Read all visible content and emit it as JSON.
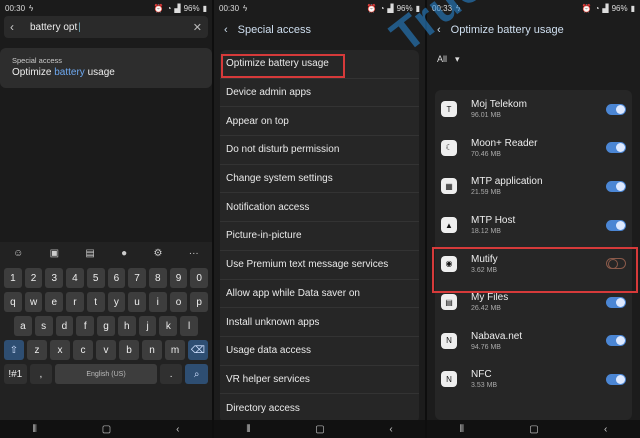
{
  "panel1": {
    "status": {
      "time": "00:30",
      "battery": "96%"
    },
    "search": {
      "value": "battery opt"
    },
    "result": {
      "category": "Special access",
      "title_pre": "Optimize ",
      "title_hl": "battery",
      "title_post": " usage"
    },
    "keyboard": {
      "row1": [
        "1",
        "2",
        "3",
        "4",
        "5",
        "6",
        "7",
        "8",
        "9",
        "0"
      ],
      "row2": [
        "q",
        "w",
        "e",
        "r",
        "t",
        "y",
        "u",
        "i",
        "o",
        "p"
      ],
      "row3": [
        "a",
        "s",
        "d",
        "f",
        "g",
        "h",
        "j",
        "k",
        "l"
      ],
      "row4": [
        "z",
        "x",
        "c",
        "v",
        "b",
        "n",
        "m"
      ],
      "sym": "!#1",
      "comma": ",",
      "space": "English (US)",
      "period": "."
    }
  },
  "panel2": {
    "status": {
      "time": "00:30",
      "battery": "96%"
    },
    "title": "Special access",
    "items": [
      "Optimize battery usage",
      "Device admin apps",
      "Appear on top",
      "Do not disturb permission",
      "Change system settings",
      "Notification access",
      "Picture-in-picture",
      "Use Premium text message services",
      "Allow app while Data saver on",
      "Install unknown apps",
      "Usage data access",
      "VR helper services",
      "Directory access"
    ]
  },
  "panel3": {
    "status": {
      "time": "00:33",
      "battery": "96%"
    },
    "title": "Optimize battery usage",
    "filter": "All",
    "apps": [
      {
        "name": "Moj Telekom",
        "size": "96.01 MB",
        "on": true
      },
      {
        "name": "Moon+ Reader",
        "size": "70.46 MB",
        "on": true
      },
      {
        "name": "MTP application",
        "size": "21.59 MB",
        "on": true
      },
      {
        "name": "MTP Host",
        "size": "18.12 MB",
        "on": true
      },
      {
        "name": "Mutify",
        "size": "3.62 MB",
        "on": false
      },
      {
        "name": "My Files",
        "size": "26.42 MB",
        "on": true
      },
      {
        "name": "Nabava.net",
        "size": "94.76 MB",
        "on": true
      },
      {
        "name": "NFC",
        "size": "3.53 MB",
        "on": true
      }
    ]
  },
  "watermark": "Truongtin.top"
}
